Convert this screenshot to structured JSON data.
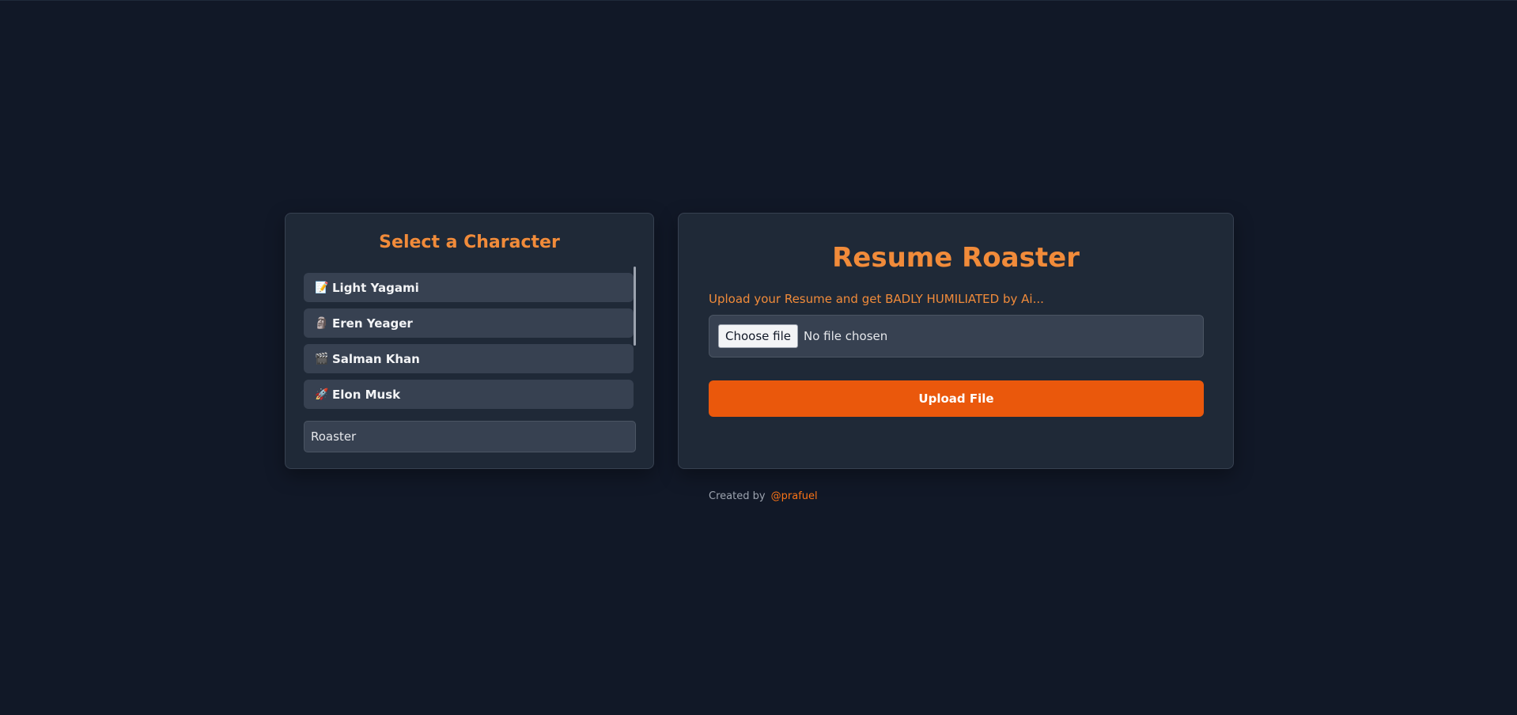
{
  "left_panel": {
    "title": "Select a Character",
    "characters": [
      {
        "icon": "📝",
        "icon_name": "memo-icon",
        "label": "Light Yagami"
      },
      {
        "icon": "🗿",
        "icon_name": "moai-icon",
        "label": "Eren Yeager"
      },
      {
        "icon": "🎬",
        "icon_name": "clapper-board-icon",
        "label": "Salman Khan"
      },
      {
        "icon": "🚀",
        "icon_name": "rocket-icon",
        "label": "Elon Musk"
      }
    ],
    "mode_input": {
      "value": "Roaster"
    }
  },
  "right_panel": {
    "title": "Resume Roaster",
    "subtitle": "Upload your Resume and get BADLY HUMILIATED by Ai...",
    "choose_file_label": "Choose file",
    "file_status": "No file chosen",
    "upload_label": "Upload File"
  },
  "footer": {
    "prefix": "Created by",
    "handle": "@prafuel"
  },
  "colors": {
    "background": "#111827",
    "panel": "#1f2937",
    "accent": "#f18b3a",
    "button": "#ea580c"
  }
}
